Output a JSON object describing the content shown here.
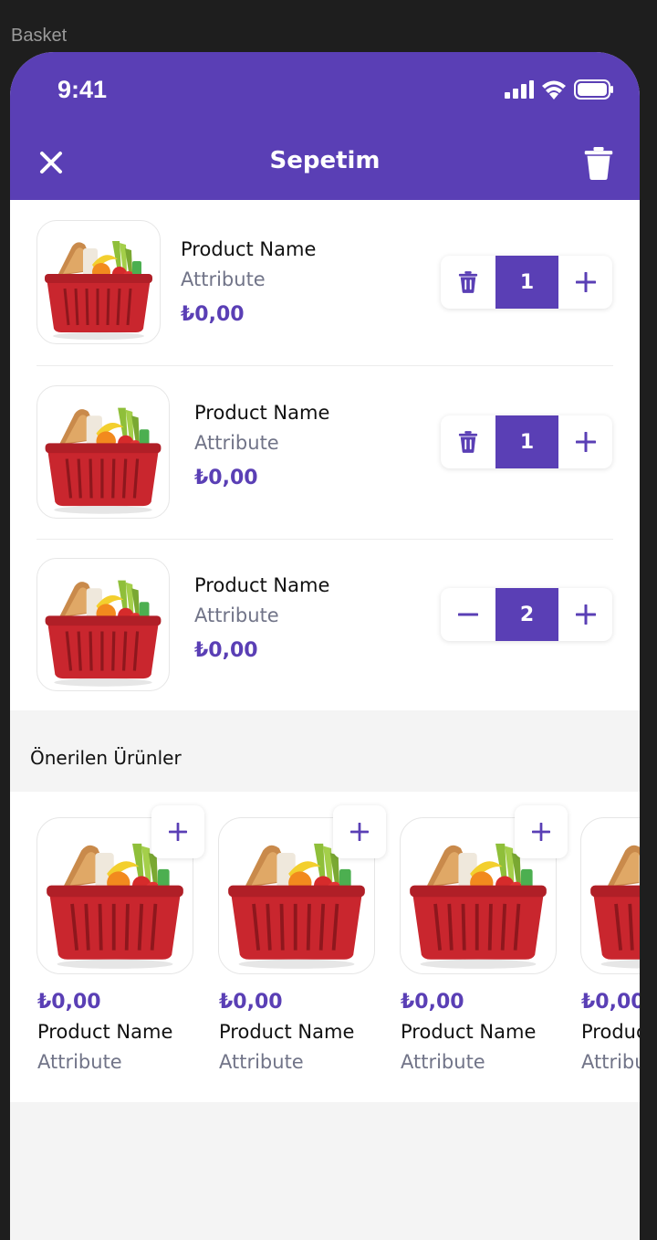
{
  "frame": {
    "label": "Basket"
  },
  "status_bar": {
    "time": "9:41"
  },
  "nav": {
    "title": "Sepetim"
  },
  "colors": {
    "brand": "#5a3fb5",
    "basket": "#c9262e",
    "text": "#111111",
    "muted": "#717488"
  },
  "basket": {
    "items": [
      {
        "name": "Product Name",
        "attribute": "Attribute",
        "price": "₺0,00",
        "quantity": "1",
        "left_action": "delete"
      },
      {
        "name": "Product Name",
        "attribute": "Attribute",
        "price": "₺0,00",
        "quantity": "1",
        "left_action": "delete"
      },
      {
        "name": "Product Name",
        "attribute": "Attribute",
        "price": "₺0,00",
        "quantity": "2",
        "left_action": "decrement"
      }
    ]
  },
  "recommended": {
    "title": "Önerilen Ürünler",
    "items": [
      {
        "price": "₺0,00",
        "name": "Product Name",
        "attribute": "Attribute"
      },
      {
        "price": "₺0,00",
        "name": "Product Name",
        "attribute": "Attribute"
      },
      {
        "price": "₺0,00",
        "name": "Product Name",
        "attribute": "Attribute"
      },
      {
        "price": "₺0,00",
        "name": "Product Name",
        "attribute": "Attribute"
      }
    ]
  }
}
